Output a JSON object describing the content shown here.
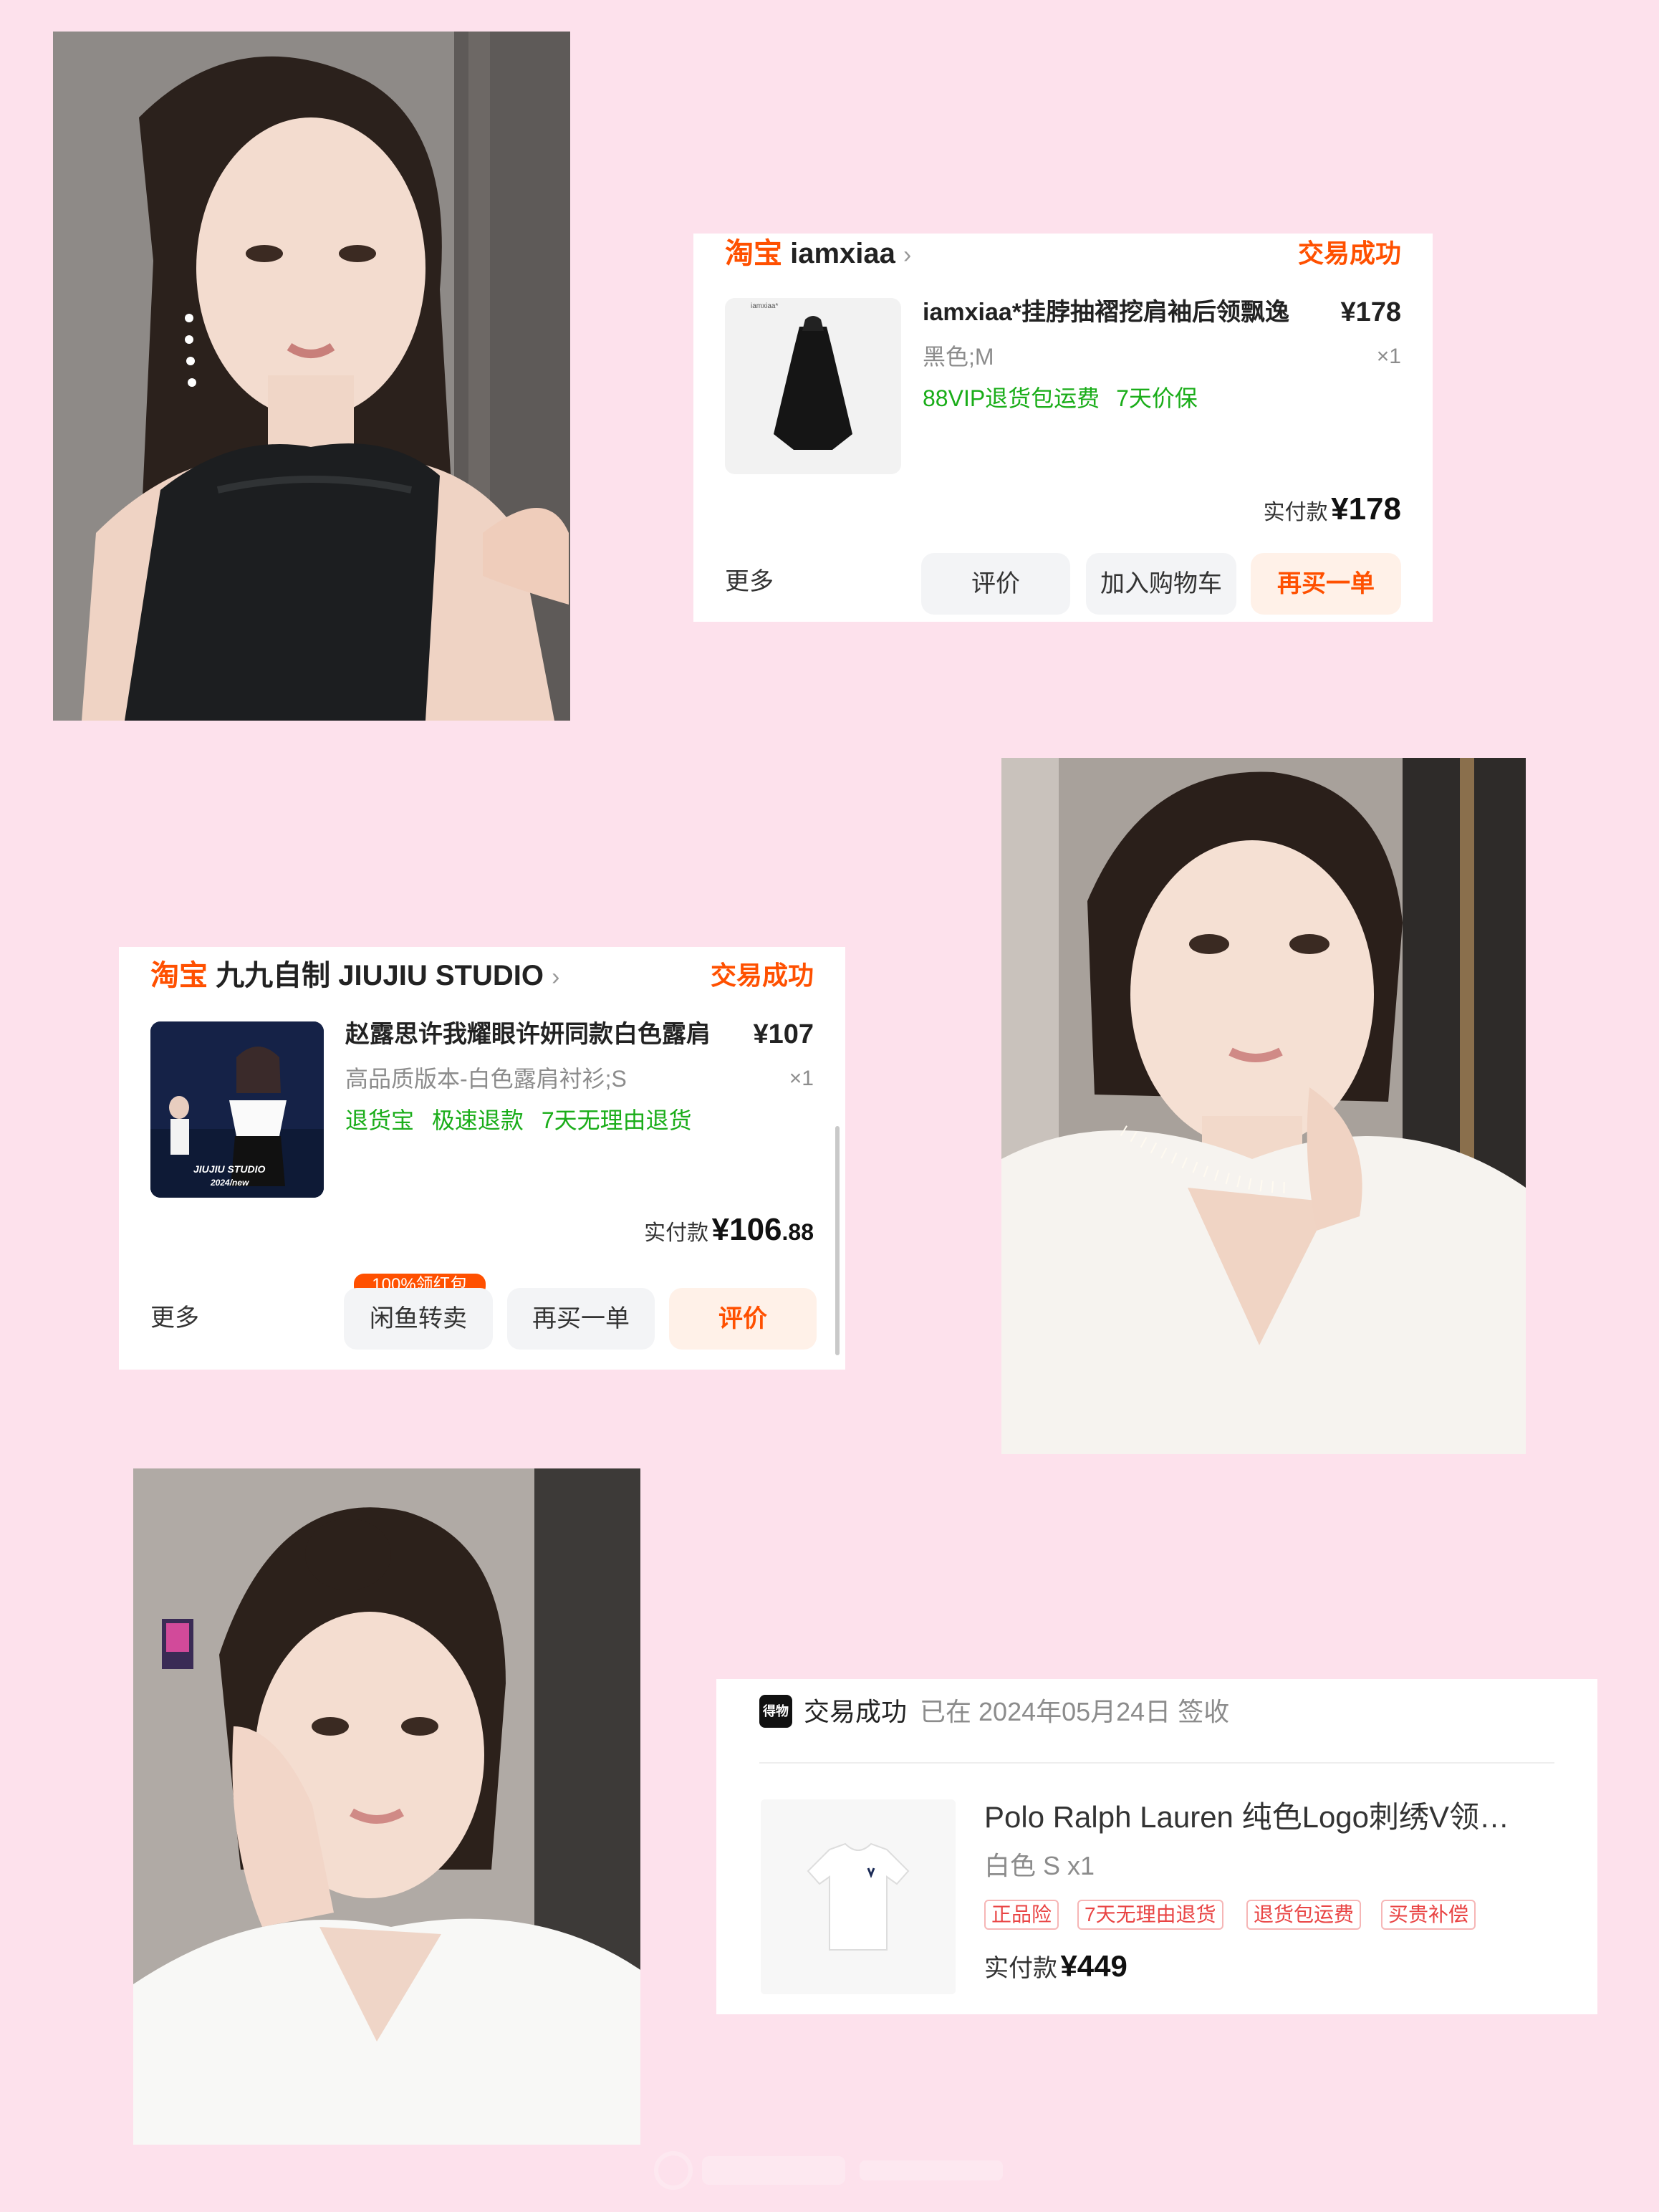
{
  "orders": [
    {
      "platform": "淘宝",
      "shop": "iamxiaa",
      "status": "交易成功",
      "product_title": "iamxiaa*挂脖抽褶挖肩袖后领飘逸",
      "thumb_label": "iamxiaa*",
      "price": "¥178",
      "spec": "黑色;M",
      "qty": "×1",
      "promos": [
        "88VIP退货包运费",
        "7天价保"
      ],
      "paid_label": "实付款",
      "paid_amount": "¥178",
      "more_label": "更多",
      "buttons": [
        "评价",
        "加入购物车",
        "再买一单"
      ]
    },
    {
      "platform": "淘宝",
      "shop": "九九自制 JIUJIU STUDIO",
      "status": "交易成功",
      "product_title": "赵露思许我耀眼许妍同款白色露肩",
      "thumb_caption_1": "JIUJIU STUDIO",
      "thumb_caption_2": "2024/new",
      "price": "¥107",
      "spec": "高品质版本-白色露肩衬衫;S",
      "qty": "×1",
      "promos": [
        "退货宝",
        "极速退款",
        "7天无理由退货"
      ],
      "paid_label": "实付款",
      "paid_amount_int": "¥106",
      "paid_amount_dec": ".88",
      "more_label": "更多",
      "badge": "100%领红包",
      "buttons": [
        "闲鱼转卖",
        "再买一单",
        "评价"
      ]
    },
    {
      "platform_logo_text": "得物",
      "status": "交易成功",
      "signed_note": "已在 2024年05月24日 签收",
      "product_title": "Polo Ralph Lauren 纯色Logo刺绣V领…",
      "spec": "白色 S x1",
      "tags": [
        "正品险",
        "7天无理由退货",
        "退货包运费",
        "买贵补偿"
      ],
      "paid_label": "实付款",
      "paid_amount": "¥449"
    }
  ],
  "colors": {
    "background": "#fde1ec",
    "taobao_orange": "#ff5000",
    "promo_green": "#1aad19",
    "tag_red": "#e94545"
  }
}
